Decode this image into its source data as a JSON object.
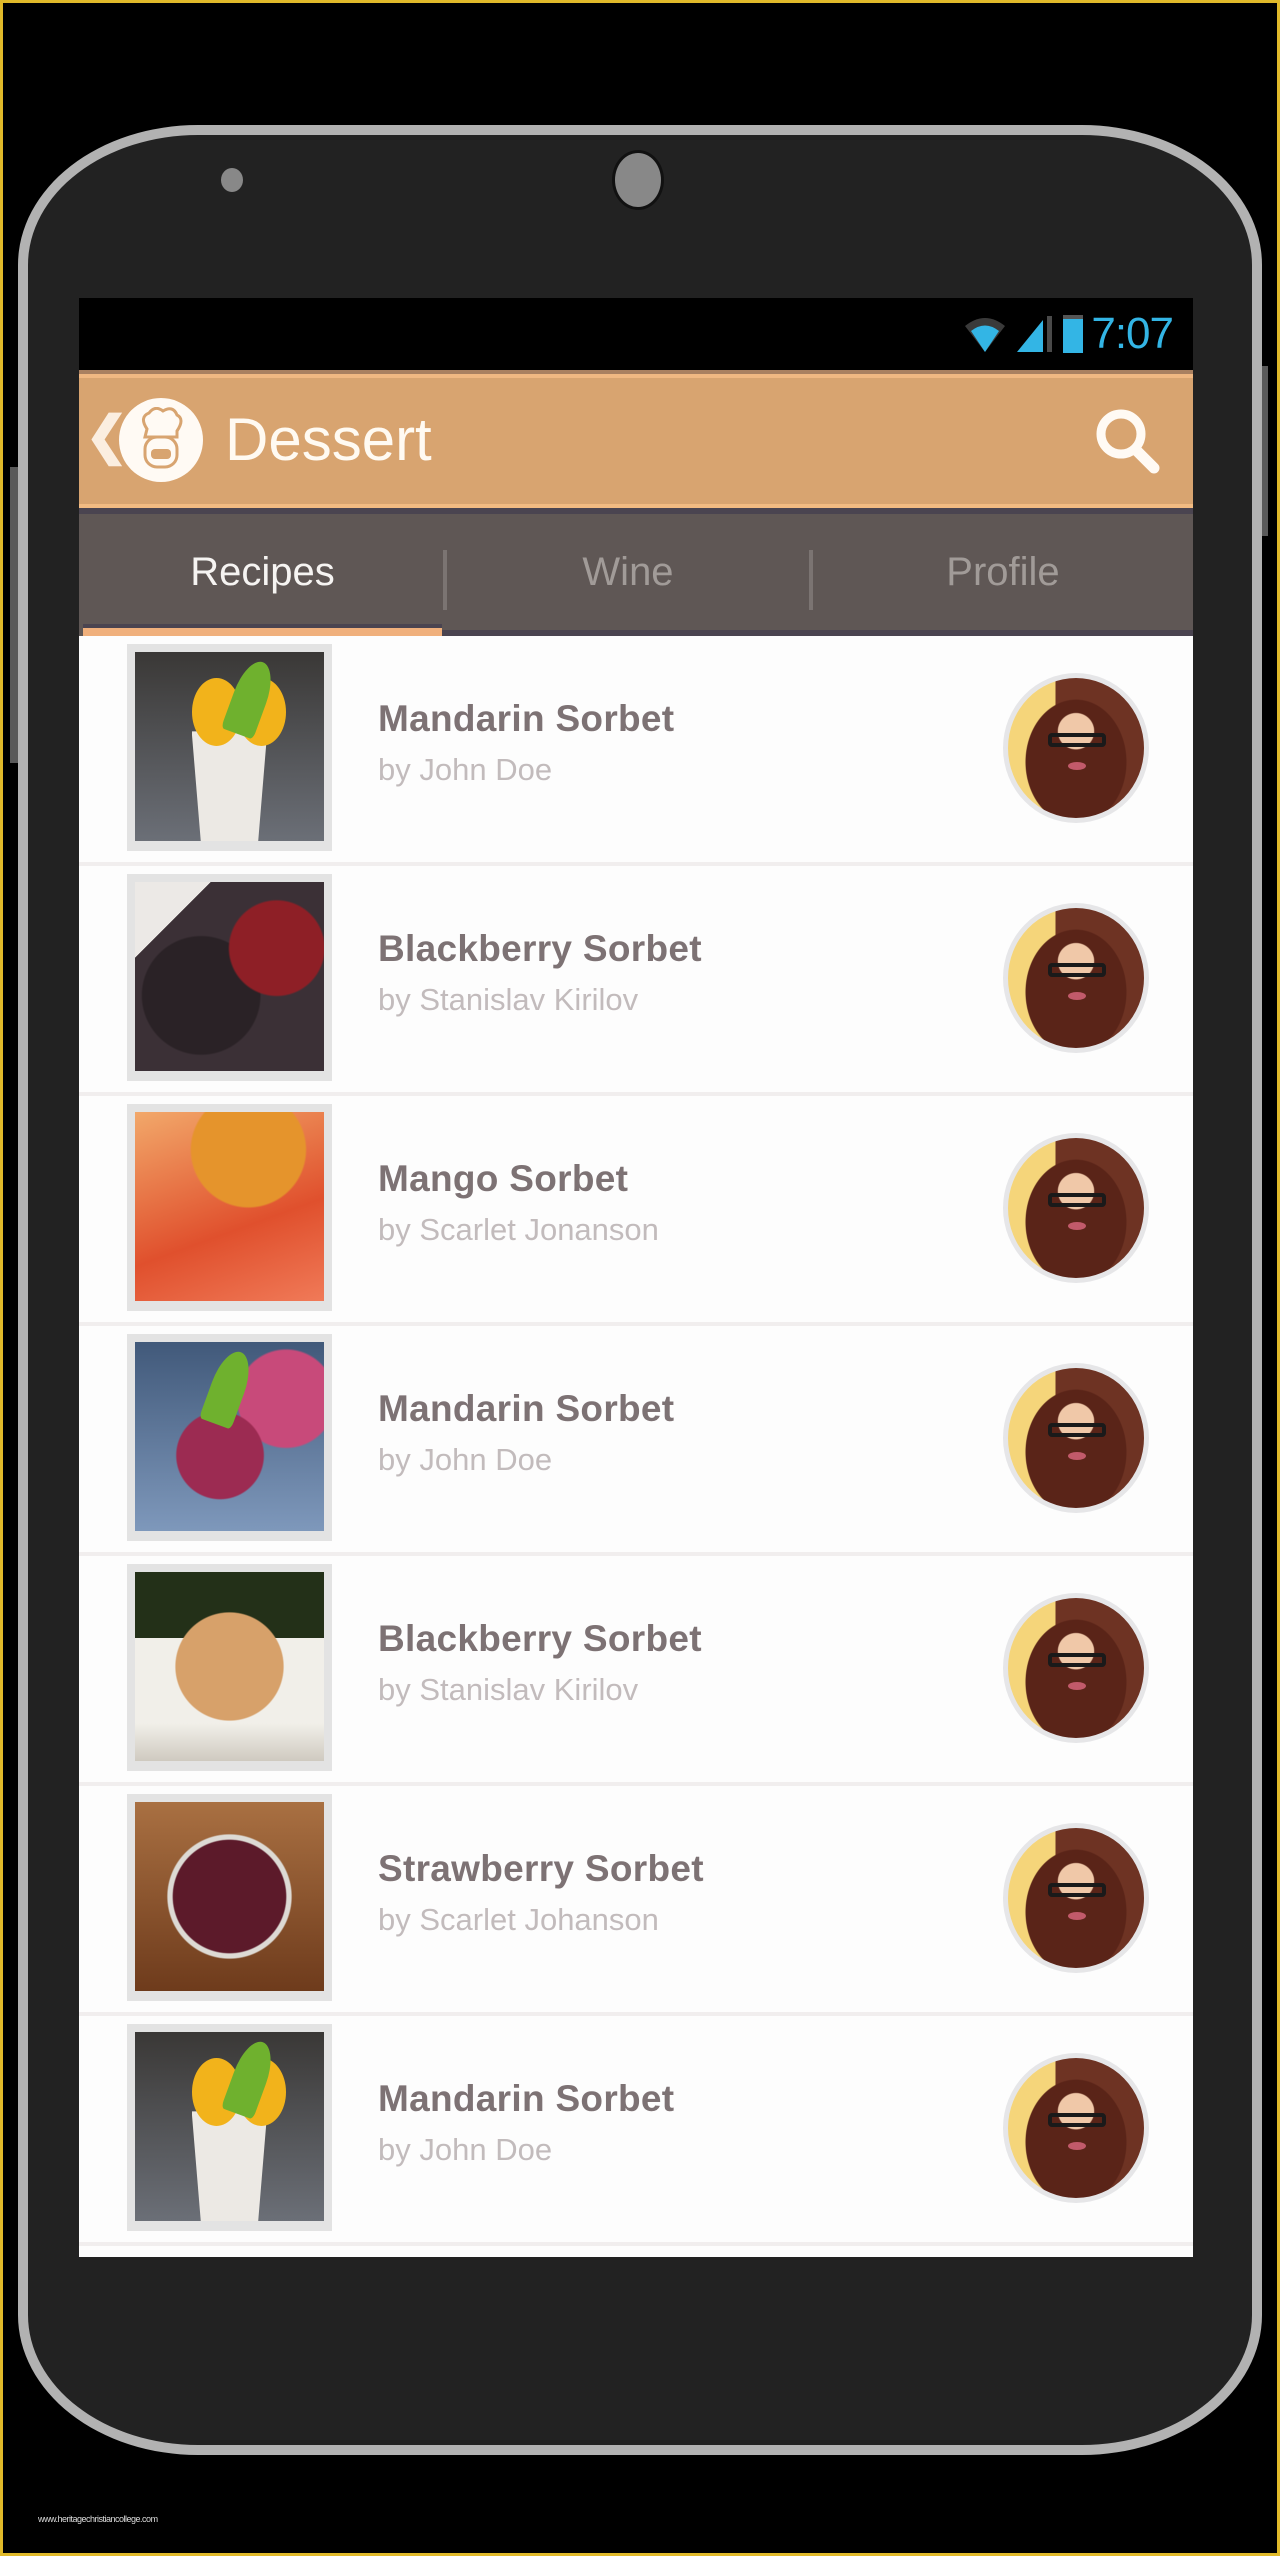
{
  "status_bar": {
    "time": "7:07",
    "icons": [
      "wifi-icon",
      "cell-signal-icon",
      "battery-icon"
    ],
    "accent_color": "#33b5e5"
  },
  "app_bar": {
    "back_icon": "chevron-left-icon",
    "logo_icon": "chef-hat-icon",
    "title": "Dessert",
    "search_icon": "search-icon",
    "color": "#d8a470"
  },
  "tabs": [
    {
      "label": "Recipes",
      "active": true
    },
    {
      "label": "Wine",
      "active": false
    },
    {
      "label": "Profile",
      "active": false
    }
  ],
  "recipes": [
    {
      "title": "Mandarin Sorbet",
      "author": "by John Doe"
    },
    {
      "title": "Blackberry Sorbet",
      "author": "by Stanislav Kirilov"
    },
    {
      "title": "Mango Sorbet",
      "author": "by Scarlet Jonanson"
    },
    {
      "title": "Mandarin Sorbet",
      "author": "by John Doe"
    },
    {
      "title": "Blackberry Sorbet",
      "author": "by Stanislav Kirilov"
    },
    {
      "title": "Strawberry Sorbet",
      "author": "by Scarlet Johanson"
    },
    {
      "title": "Mandarin Sorbet",
      "author": "by John Doe"
    }
  ],
  "watermark": "www.heritagechristiancollege.com"
}
